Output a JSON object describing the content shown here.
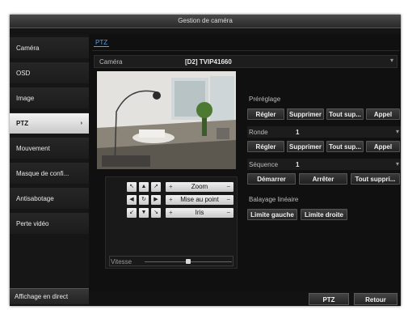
{
  "window": {
    "title": "Gestion de caméra"
  },
  "sidebar": {
    "items": [
      {
        "label": "Caméra"
      },
      {
        "label": "OSD"
      },
      {
        "label": "Image"
      },
      {
        "label": "PTZ",
        "arrow": "›"
      },
      {
        "label": "Mouvement"
      },
      {
        "label": "Masque de confi..."
      },
      {
        "label": "Antisabotage"
      },
      {
        "label": "Perte vidéo"
      }
    ],
    "live_view": "Affichage en direct"
  },
  "main": {
    "tab": "PTZ",
    "camera": {
      "label": "Caméra",
      "value": "[D2] TVIP41660"
    },
    "prereglage": {
      "label": "Préréglage",
      "buttons": [
        "Régler",
        "Supprimer",
        "Tout sup...",
        "Appel"
      ]
    },
    "ronde": {
      "label": "Ronde",
      "value": "1",
      "buttons": [
        "Régler",
        "Supprimer",
        "Tout sup...",
        "Appel"
      ]
    },
    "sequence": {
      "label": "Séquence",
      "value": "1",
      "buttons": [
        "Démarrer",
        "Arrêter",
        "Tout suppri..."
      ]
    },
    "balayage": {
      "label": "Balayage linéaire",
      "buttons": [
        "Limite gauche",
        "Limite droite"
      ]
    },
    "controls": {
      "zoom": "Zoom",
      "focus": "Mise au point",
      "iris": "Iris",
      "vitesse": "Vitesse",
      "speed_level": 0.5
    }
  },
  "bottom": {
    "ptz": "PTZ",
    "retour": "Retour"
  },
  "colors": {
    "accent": "#4aa3ff",
    "active_item": "#e6e6e6",
    "background": "#141414"
  }
}
